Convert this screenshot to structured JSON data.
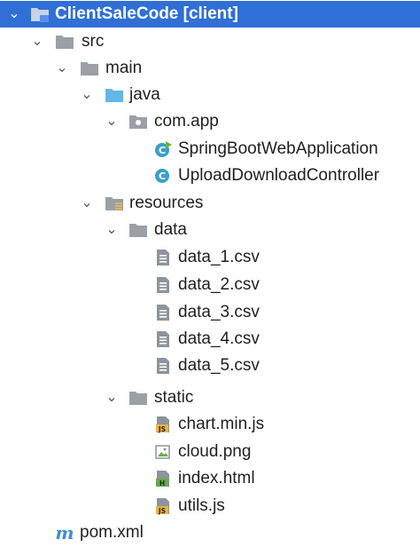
{
  "tree": {
    "root": {
      "label": "ClientSaleCode [client]",
      "icon": "module-folder-icon",
      "expanded": true,
      "selected": true
    },
    "src": {
      "label": "src",
      "icon": "folder-icon",
      "expanded": true
    },
    "main": {
      "label": "main",
      "icon": "folder-icon",
      "expanded": true
    },
    "java": {
      "label": "java",
      "icon": "source-root-folder-icon",
      "expanded": true
    },
    "package": {
      "label": "com.app",
      "icon": "package-icon",
      "expanded": true
    },
    "classes": [
      {
        "label": "SpringBootWebApplication",
        "icon": "spring-boot-class-icon"
      },
      {
        "label": "UploadDownloadController",
        "icon": "class-icon"
      }
    ],
    "resources": {
      "label": "resources",
      "icon": "resources-folder-icon",
      "expanded": true
    },
    "data_folder": {
      "label": "data",
      "icon": "folder-icon",
      "expanded": true
    },
    "data_files": [
      {
        "label": "data_1.csv",
        "icon": "text-file-icon"
      },
      {
        "label": "data_2.csv",
        "icon": "text-file-icon"
      },
      {
        "label": "data_3.csv",
        "icon": "text-file-icon"
      },
      {
        "label": "data_4.csv",
        "icon": "text-file-icon"
      },
      {
        "label": "data_5.csv",
        "icon": "text-file-icon"
      }
    ],
    "static_folder": {
      "label": "static",
      "icon": "folder-icon",
      "expanded": true
    },
    "static_files": [
      {
        "label": "chart.min.js",
        "icon": "js-file-icon"
      },
      {
        "label": "cloud.png",
        "icon": "image-file-icon"
      },
      {
        "label": "index.html",
        "icon": "html-file-icon"
      },
      {
        "label": "utils.js",
        "icon": "js-file-icon"
      }
    ],
    "pom": {
      "label": "pom.xml",
      "icon": "maven-icon"
    }
  },
  "colors": {
    "selection": "#2f6fd6",
    "folder": "#9aa0a6",
    "source_folder": "#62b6e8",
    "spring_green": "#6cb33e",
    "class_cyan": "#3aa0c8",
    "js_yellow": "#e6b34a",
    "html_green": "#6aa84f",
    "maven_blue": "#3d8ed6"
  }
}
